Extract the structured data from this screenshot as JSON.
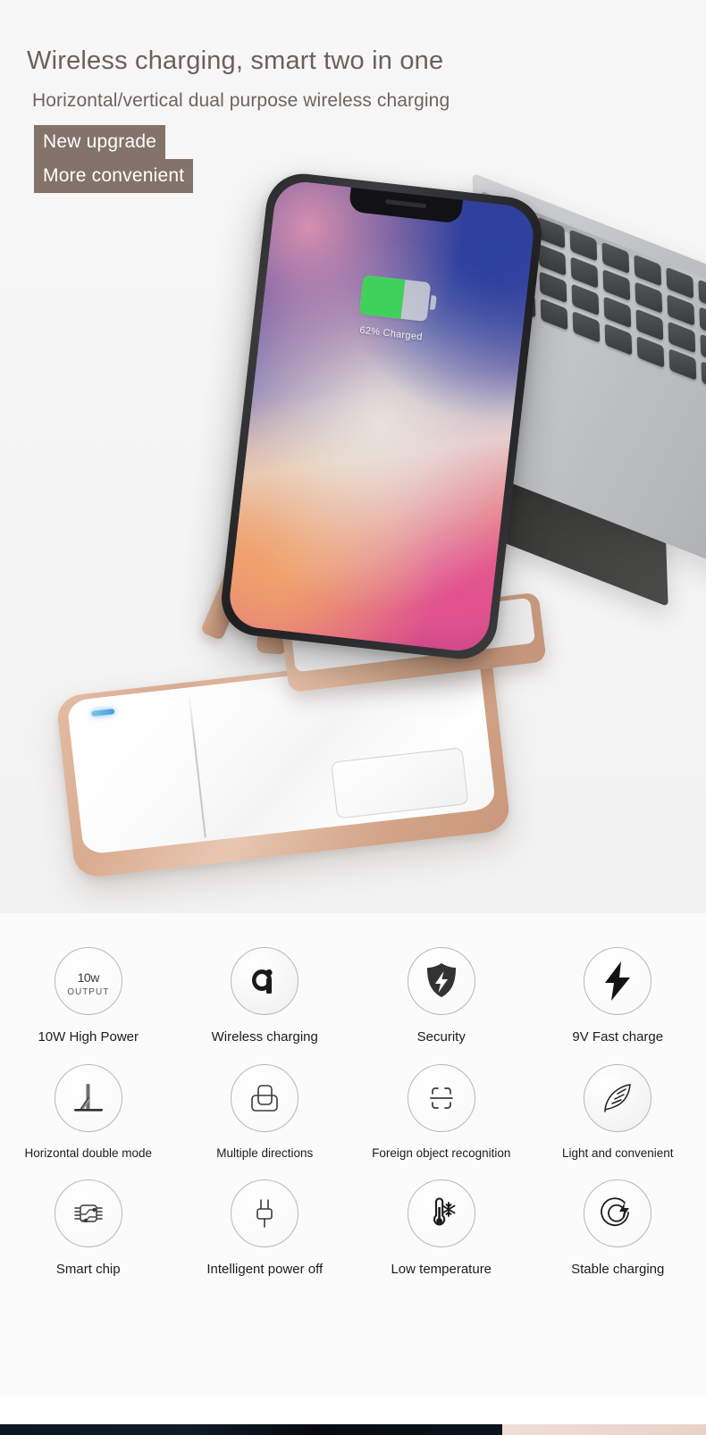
{
  "hero": {
    "headline": "Wireless charging, smart two in one",
    "subheadline": "Horizontal/vertical dual purpose wireless charging",
    "badges": [
      {
        "label": "New upgrade"
      },
      {
        "label": "More convenient"
      }
    ],
    "badge_bg_color": "#847369",
    "badge_text_color": "#ffffff",
    "headline_color": "#6b6159",
    "background_color": "#f5f5f5",
    "product": {
      "phone": {
        "battery_percent": 62,
        "battery_status": "62% Charged",
        "battery_fill_color": "#3fd15a",
        "name": "smartphone-on-stand"
      },
      "charger": {
        "name": "wireless-charging-pad",
        "body_color": "#ffffff",
        "trim_color": "#d9ab8f",
        "led_color": "#3f9fe0"
      },
      "laptop": {
        "name": "laptop",
        "body_color": "#c3c5c7"
      }
    }
  },
  "features": {
    "rows": [
      {
        "items": [
          {
            "icon": "ten-watt-output-icon",
            "label": "10W High Power",
            "icon_text_primary": "10",
            "icon_text_unit": "w",
            "icon_text_secondary": "OUTPUT"
          },
          {
            "icon": "qi-logo-icon",
            "label": "Wireless charging",
            "icon_text_primary": "Qi"
          },
          {
            "icon": "shield-lightning-icon",
            "label": "Security"
          },
          {
            "icon": "lightning-bolt-icon",
            "label": "9V Fast charge"
          }
        ]
      },
      {
        "items": [
          {
            "icon": "stand-easel-icon",
            "label": "Horizontal double mode"
          },
          {
            "icon": "multiple-orientations-icon",
            "label": "Multiple directions"
          },
          {
            "icon": "object-detection-frame-icon",
            "label": "Foreign object recognition"
          },
          {
            "icon": "feather-icon",
            "label": "Light and convenient"
          }
        ]
      },
      {
        "items": [
          {
            "icon": "smart-chip-icon",
            "label": "Smart chip"
          },
          {
            "icon": "power-plug-icon",
            "label": "Intelligent power off"
          },
          {
            "icon": "thermometer-snowflake-icon",
            "label": "Low temperature"
          },
          {
            "icon": "stable-charging-target-icon",
            "label": "Stable charging"
          }
        ]
      }
    ]
  }
}
